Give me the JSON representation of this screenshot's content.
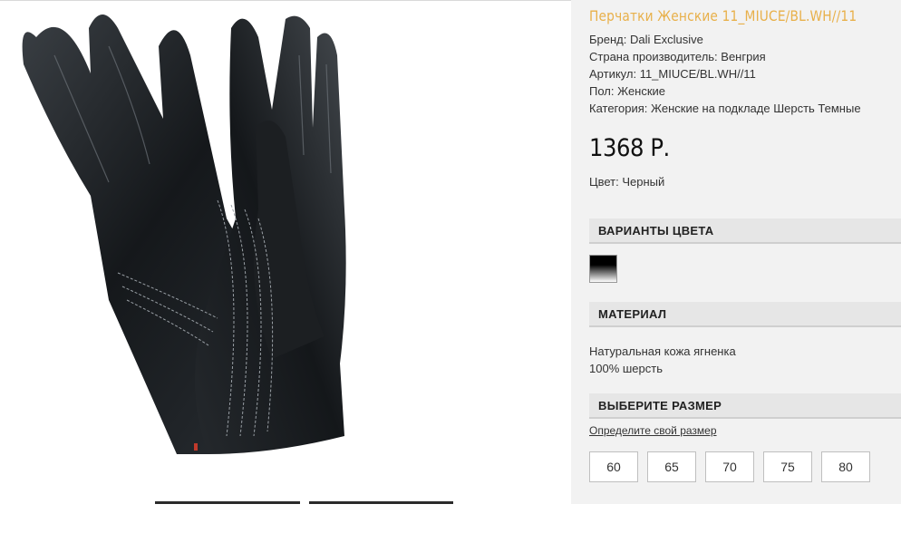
{
  "product": {
    "title": "Перчатки Женские 11_MIUCE/BL.WH//11",
    "specs": [
      "Бренд: Dali Exclusive",
      "Страна производитель: Венгрия",
      "Артикул: 11_MIUCE/BL.WH//11",
      "Пол: Женские",
      "Категория: Женские на подкладе Шерсть Темные"
    ],
    "price": "1368 Р.",
    "color": "Цвет: Черный"
  },
  "sections": {
    "color_variants": "ВАРИАНТЫ ЦВЕТА",
    "material": "МАТЕРИАЛ",
    "size": "ВЫБЕРИТЕ РАЗМЕР"
  },
  "material_lines": [
    "Натуральная кожа ягненка",
    "100% шерсть"
  ],
  "size_link": "Определите свой размер",
  "sizes": [
    "60",
    "65",
    "70",
    "75",
    "80"
  ],
  "colors": {
    "title": "#e8b04a",
    "panel_bg": "#f2f2f2",
    "section_bg": "#e6e6e6"
  }
}
